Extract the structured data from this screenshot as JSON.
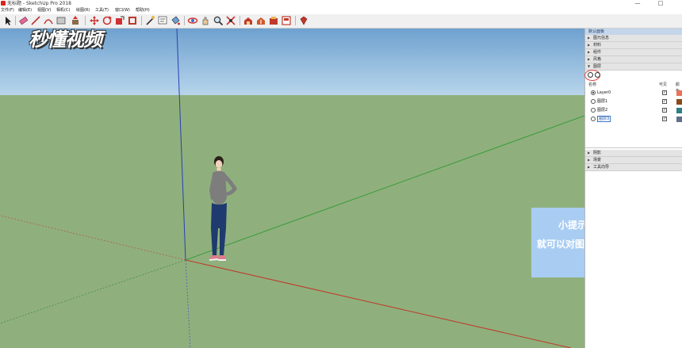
{
  "window": {
    "title": "无标题 - SketchUp Pro 2018",
    "minimize_glyph": "—",
    "maximize_glyph": "□"
  },
  "menu": [
    "文件(F)",
    "编辑(E)",
    "视图(V)",
    "相机(C)",
    "绘图(R)",
    "工具(T)",
    "窗口(W)",
    "帮助(H)"
  ],
  "toolbar_icons": [
    "select-icon",
    "eraser-icon",
    "line-icon",
    "arc-icon",
    "shape-icon",
    "push-pull-icon",
    "move-icon",
    "rotate-icon",
    "scale-icon",
    "offset-icon",
    "tape-measure-icon",
    "text-icon",
    "paint-bucket-icon",
    "orbit-icon",
    "pan-icon",
    "zoom-icon",
    "zoom-extents-icon",
    "warehouse-icon",
    "share-model-icon",
    "extension-warehouse-icon",
    "layout-icon",
    "ruby-icon"
  ],
  "watermark": "秒懂视频",
  "tip": {
    "title": "小提示：",
    "body": "就可以对图层进行管理"
  },
  "panel": {
    "header": "默认面板",
    "sections_top": [
      "图元信息",
      "材料",
      "组件",
      "风格",
      "图层"
    ],
    "layer_columns": {
      "name": "名称",
      "visible": "可见",
      "color": "颜色"
    },
    "layers": [
      {
        "name": "Layer0",
        "active": true,
        "visible": true,
        "color": "#e9735a"
      },
      {
        "name": "图层1",
        "active": false,
        "visible": true,
        "color": "#8a4a1c"
      },
      {
        "name": "图层2",
        "active": false,
        "visible": true,
        "color": "#2e7f86"
      },
      {
        "name": "图层3",
        "active": false,
        "visible": true,
        "color": "#5f6f8c",
        "editing": true
      }
    ],
    "sections_bottom": [
      "阴影",
      "场景",
      "工具向导"
    ]
  },
  "colors": {
    "sky": "#8fbbe0",
    "ground": "#8fb07d",
    "axis_red": "#c0392b",
    "axis_green": "#3a9a3a",
    "axis_blue": "#2a3fb0",
    "tip_box": "#a9cdf2"
  }
}
